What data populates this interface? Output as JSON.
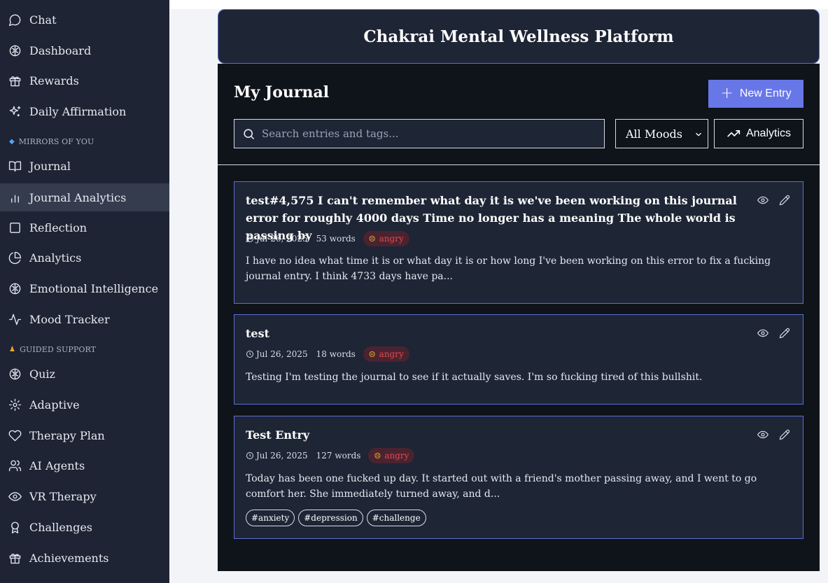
{
  "sidebar": {
    "items_top": [
      {
        "label": "Chat",
        "icon": "chat-icon"
      },
      {
        "label": "Dashboard",
        "icon": "brain-icon"
      },
      {
        "label": "Rewards",
        "icon": "gift-icon"
      },
      {
        "label": "Daily Affirmation",
        "icon": "sparkles-icon"
      }
    ],
    "section_mirrors": "MIRRORS OF YOU",
    "items_mirrors": [
      {
        "label": "Journal",
        "icon": "book-icon"
      },
      {
        "label": "Journal Analytics",
        "icon": "bar-chart-icon",
        "active": true
      },
      {
        "label": "Reflection",
        "icon": "square-icon"
      },
      {
        "label": "Analytics",
        "icon": "pie-chart-icon"
      },
      {
        "label": "Emotional Intelligence",
        "icon": "brain-icon"
      },
      {
        "label": "Mood Tracker",
        "icon": "activity-icon"
      }
    ],
    "section_guided": "GUIDED SUPPORT",
    "items_guided": [
      {
        "label": "Quiz",
        "icon": "brain-icon"
      },
      {
        "label": "Adaptive",
        "icon": "gear-icon"
      },
      {
        "label": "Therapy Plan",
        "icon": "heart-icon"
      },
      {
        "label": "AI Agents",
        "icon": "users-icon"
      },
      {
        "label": "VR Therapy",
        "icon": "eye-icon"
      },
      {
        "label": "Challenges",
        "icon": "award-icon"
      },
      {
        "label": "Achievements",
        "icon": "gift-icon"
      }
    ]
  },
  "header": {
    "title": "Chakrai Mental Wellness Platform"
  },
  "journal": {
    "title": "My Journal",
    "new_entry_label": "New Entry",
    "search_placeholder": "Search entries and tags...",
    "mood_filter": "All Moods",
    "analytics_label": "Analytics"
  },
  "entries": [
    {
      "title": "test#4,575 I can't remember what day it is we've been working on this journal error for roughly 4000 days Time no longer has a meaning The whole world is passing by",
      "date": "Jul 26, 2025",
      "words": "53 words",
      "mood": "angry",
      "excerpt": "I have no idea what time it is or what day it is or how long I've been working on this error to fix a fucking journal entry. I think 4733 days have pa...",
      "tags": []
    },
    {
      "title": "test",
      "date": "Jul 26, 2025",
      "words": "18 words",
      "mood": "angry",
      "excerpt": "Testing I'm testing the journal to see if it actually saves. I'm so fucking tired of this bullshit.",
      "tags": []
    },
    {
      "title": "Test Entry",
      "date": "Jul 26, 2025",
      "words": "127 words",
      "mood": "angry",
      "excerpt": "Today has been one fucked up day. It started out with a friend's mother passing away, and I went to go comfort her. She immediately turned away, and d...",
      "tags": [
        "#anxiety",
        "#depression",
        "#challenge"
      ]
    }
  ],
  "colors": {
    "sidebar_bg": "#1e2433",
    "accent": "#6877e8",
    "card_border": "#5c6fd4",
    "mood_angry": "#e5484d"
  }
}
